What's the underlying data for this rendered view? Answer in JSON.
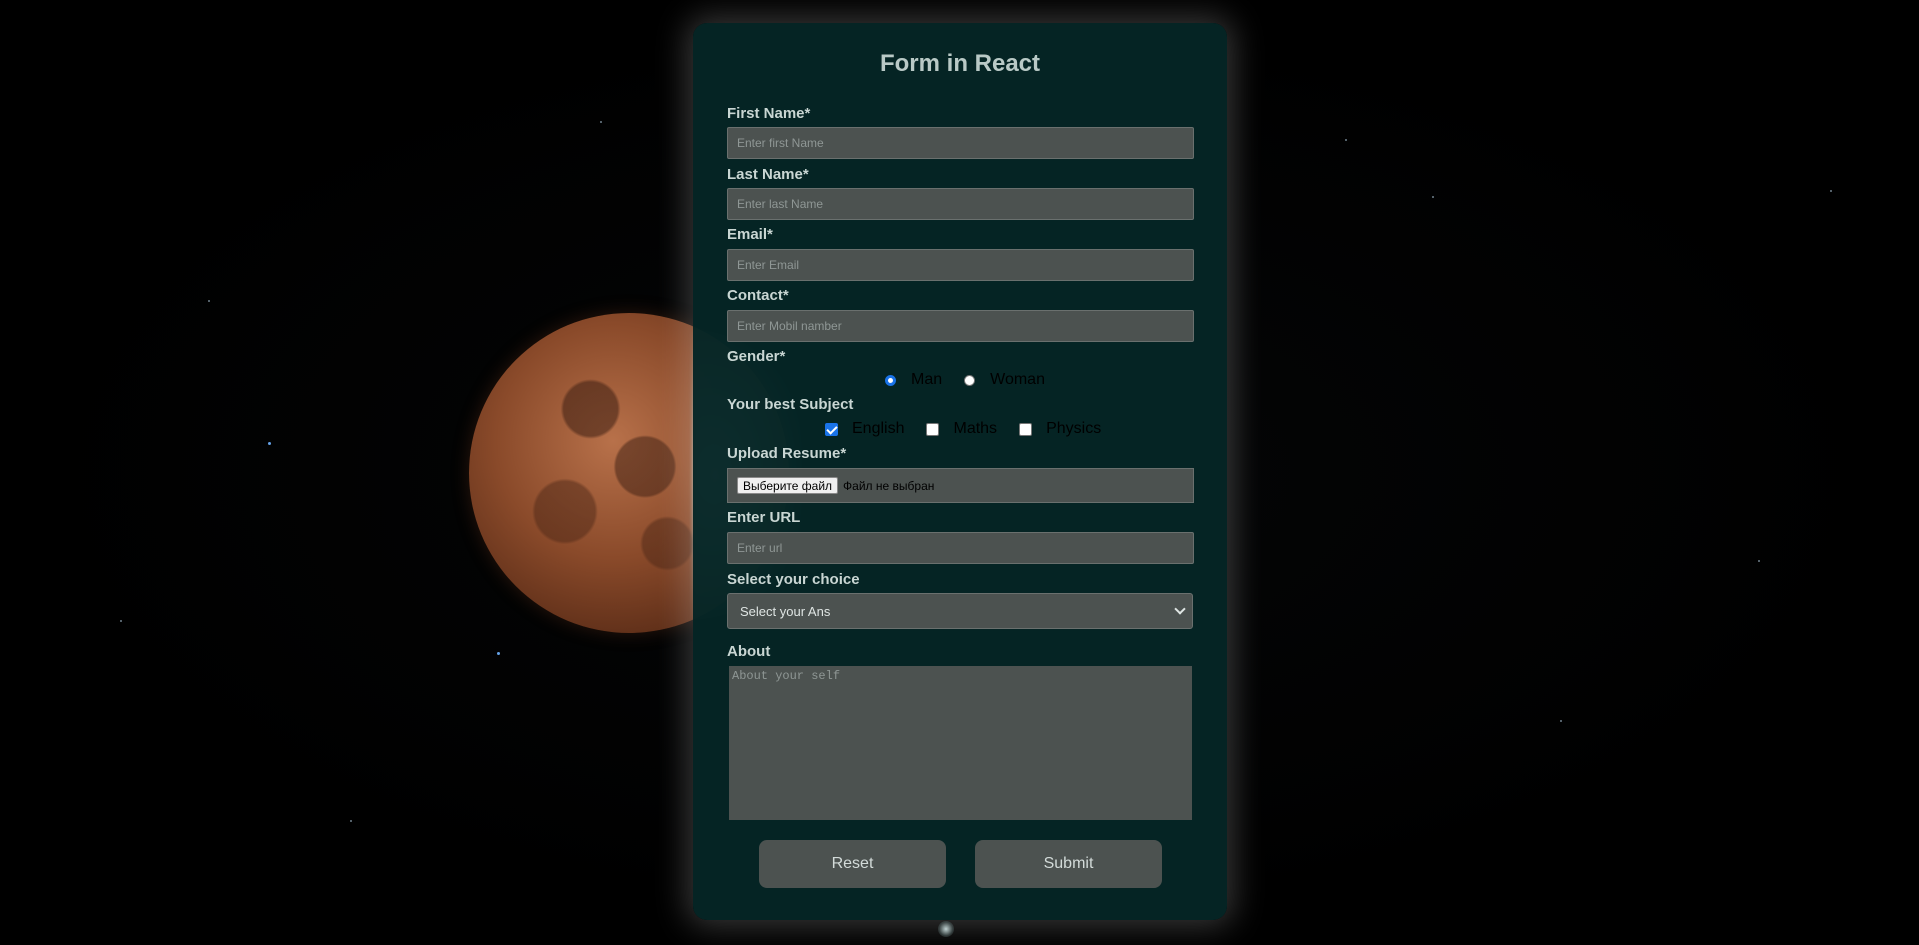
{
  "form": {
    "title": "Form in React",
    "first_name": {
      "label": "First Name*",
      "placeholder": "Enter first Name"
    },
    "last_name": {
      "label": "Last Name*",
      "placeholder": "Enter last Name"
    },
    "email": {
      "label": "Email*",
      "placeholder": "Enter Email"
    },
    "contact": {
      "label": "Contact*",
      "placeholder": "Enter Mobil namber"
    },
    "gender": {
      "label": "Gender*",
      "options": [
        {
          "label": "Man",
          "checked": true
        },
        {
          "label": "Woman",
          "checked": false
        }
      ]
    },
    "subject": {
      "label": "Your best Subject",
      "options": [
        {
          "label": "English",
          "checked": true
        },
        {
          "label": "Maths",
          "checked": false
        },
        {
          "label": "Physics",
          "checked": false
        }
      ]
    },
    "resume": {
      "label": "Upload Resume*",
      "button": "Выберите файл",
      "status": "Файл не выбран"
    },
    "url": {
      "label": "Enter URL",
      "placeholder": "Enter url"
    },
    "choice": {
      "label": "Select your choice",
      "selected": "Select your Ans"
    },
    "about": {
      "label": "About",
      "placeholder": "About your self"
    },
    "reset_label": "Reset",
    "submit_label": "Submit"
  },
  "colors": {
    "panel": "#052525",
    "field": "#4c5250",
    "accent": "#1a73e8",
    "label": "#c9d6d3"
  },
  "icons": {
    "select_arrow": "chevron-down-icon"
  }
}
